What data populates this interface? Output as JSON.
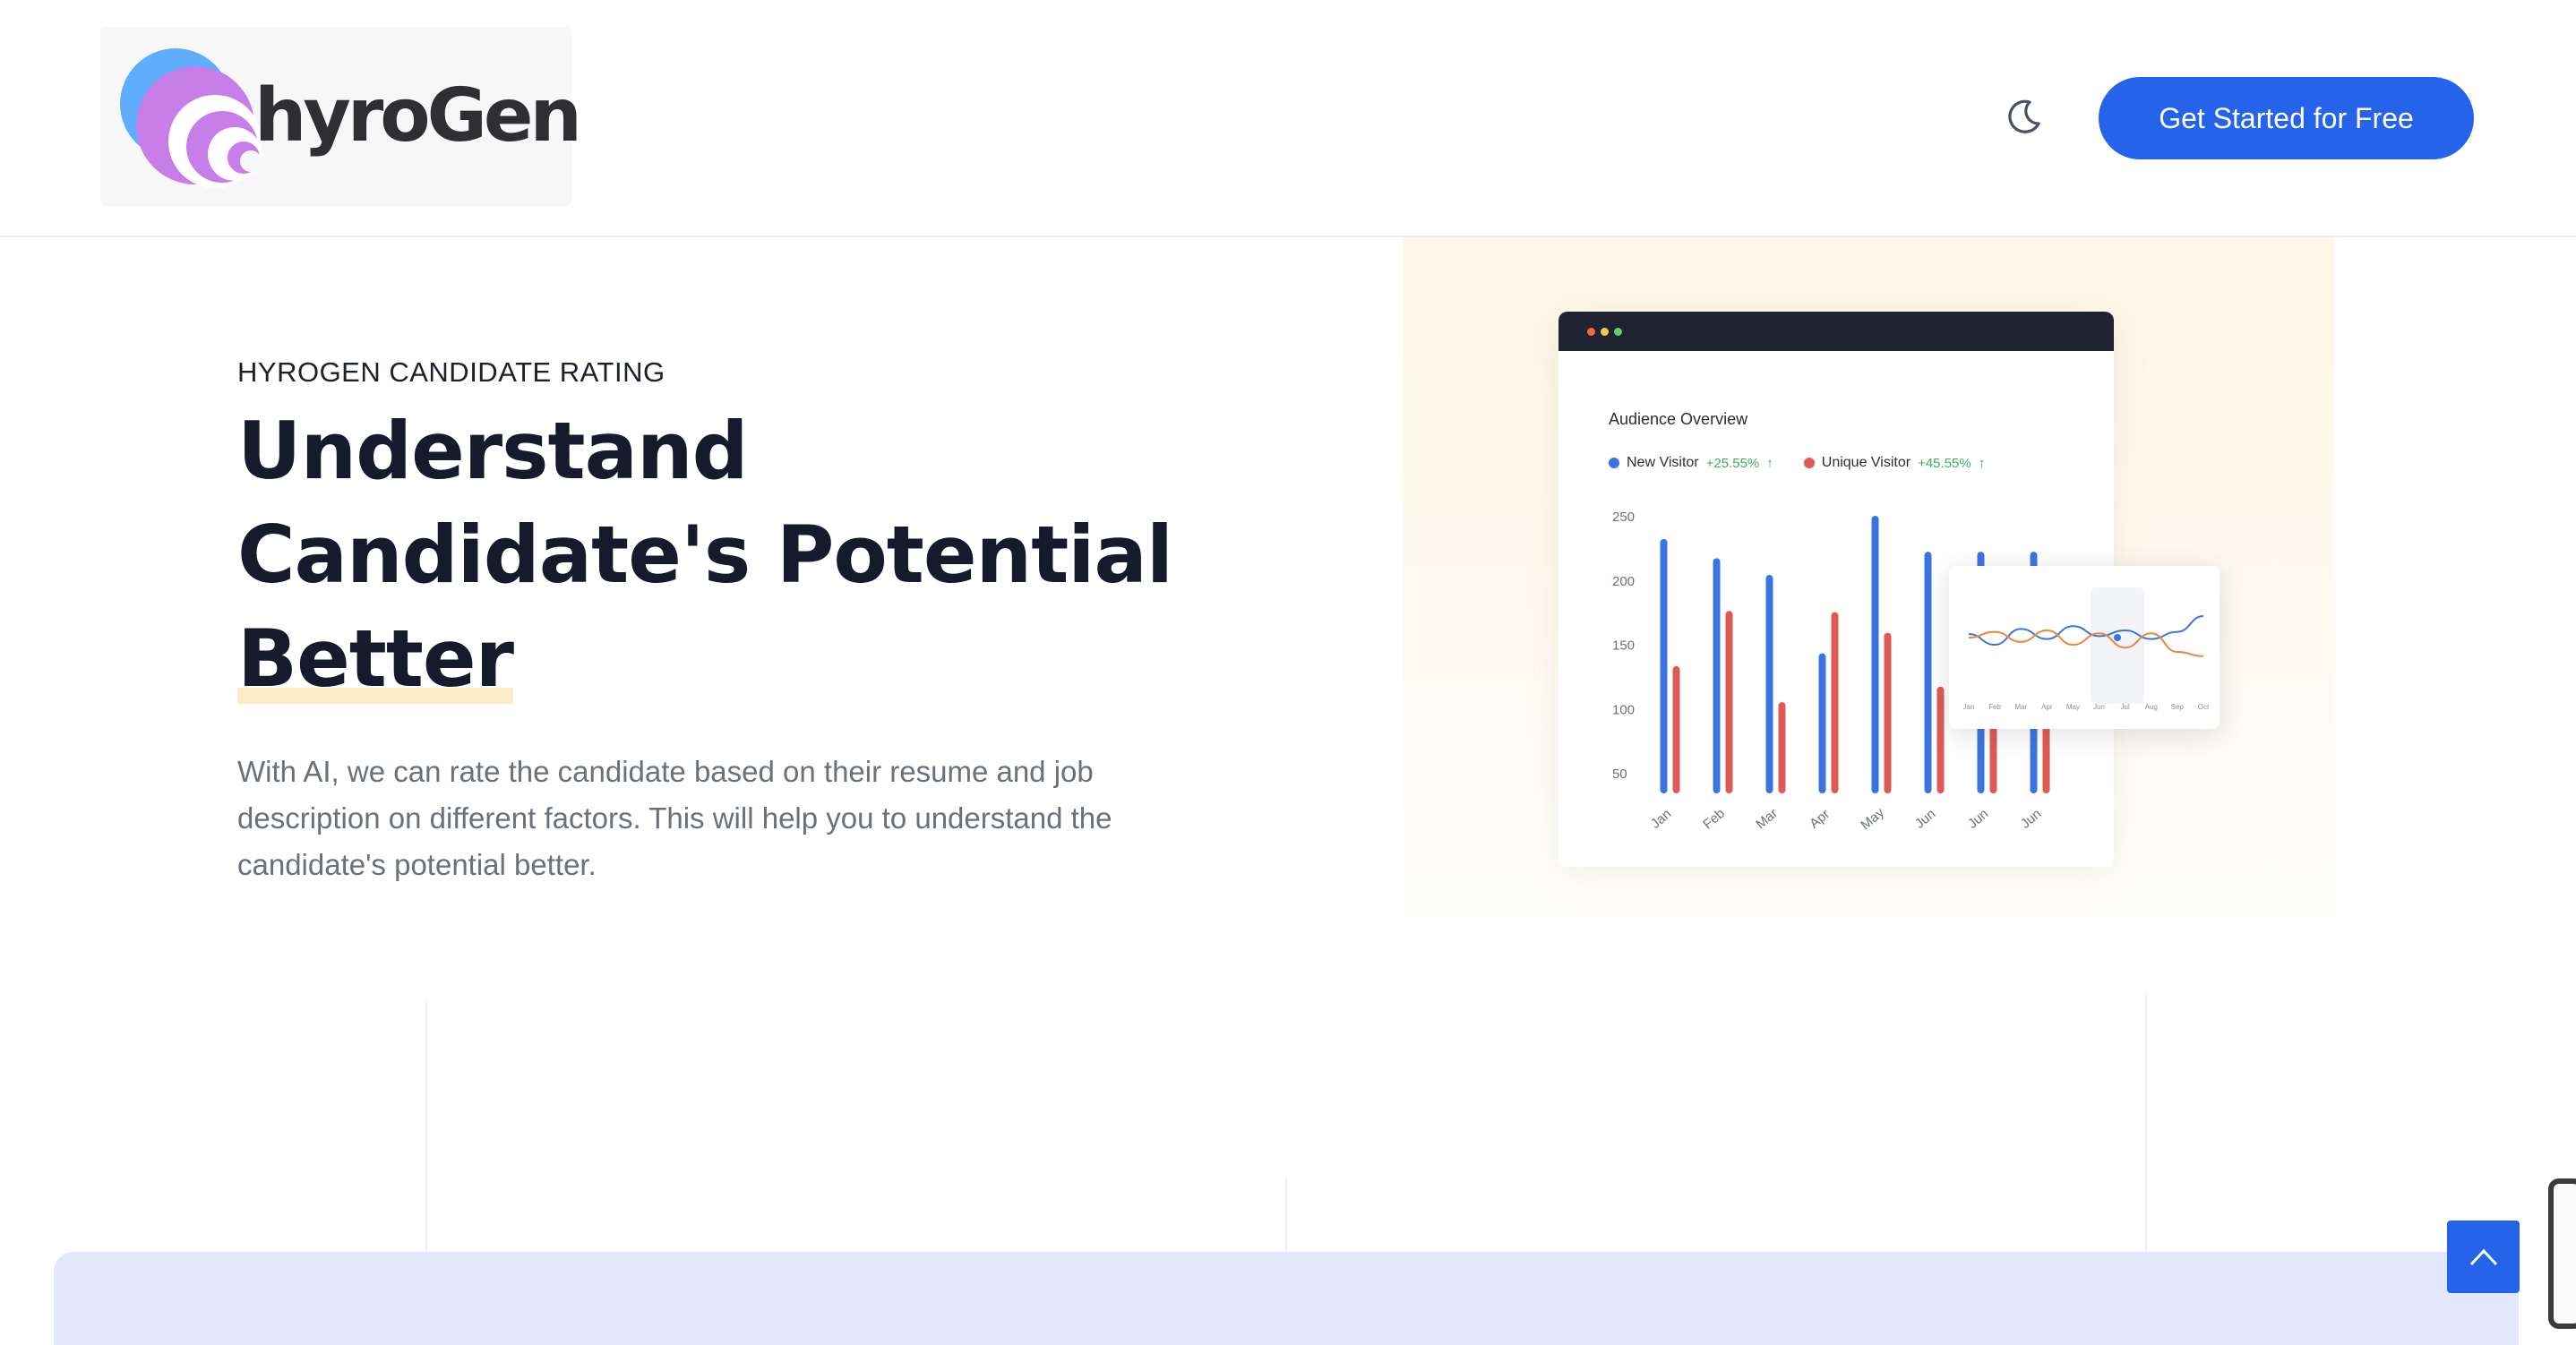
{
  "header": {
    "logo_text": "hyroGen",
    "theme_toggle_icon": "moon-icon",
    "cta_label": "Get Started for Free"
  },
  "hero": {
    "eyebrow": "HYROGEN CANDIDATE RATING",
    "headline_line1": "Understand",
    "headline_line2": "Candidate's Potential",
    "headline_line3": "Better",
    "description": "With AI, we can rate the candidate based on their resume and job description on different factors. This will help you to understand the candidate's potential better."
  },
  "dashboard": {
    "title": "Audience Overview",
    "legend": [
      {
        "label": "New Visitor",
        "pct": "+25.55%",
        "color": "#3b74e0"
      },
      {
        "label": "Unique Visitor",
        "pct": "+45.55%",
        "color": "#de5a55"
      }
    ],
    "window_dots": [
      "#f26b3a",
      "#f5c64c",
      "#5fcf6a"
    ]
  },
  "chart_data": [
    {
      "type": "bar",
      "title": "Audience Overview",
      "categories": [
        "Jan",
        "Feb",
        "Mar",
        "Apr",
        "May",
        "Jun",
        "Jun",
        "Jun"
      ],
      "yticks": [
        250,
        200,
        150,
        100,
        50
      ],
      "ylim": [
        50,
        250
      ],
      "series": [
        {
          "name": "New Visitor",
          "color": "#3b74e0",
          "values": [
            232,
            217,
            204,
            143,
            250,
            222,
            222,
            222
          ]
        },
        {
          "name": "Unique Visitor",
          "color": "#de5a55",
          "values": [
            133,
            176,
            105,
            175,
            159,
            117,
            92,
            92
          ]
        }
      ]
    },
    {
      "type": "line",
      "categories": [
        "Jan",
        "Feb",
        "Mar",
        "Apr",
        "May",
        "Jun",
        "Jul",
        "Aug",
        "Sep",
        "Oct"
      ],
      "series": [
        {
          "color": "#3b74e0",
          "values": [
            55,
            40,
            62,
            48,
            66,
            52,
            60,
            48,
            58,
            80
          ]
        },
        {
          "color": "#e8863a",
          "values": [
            50,
            58,
            44,
            60,
            40,
            56,
            36,
            56,
            30,
            24
          ]
        }
      ]
    }
  ]
}
